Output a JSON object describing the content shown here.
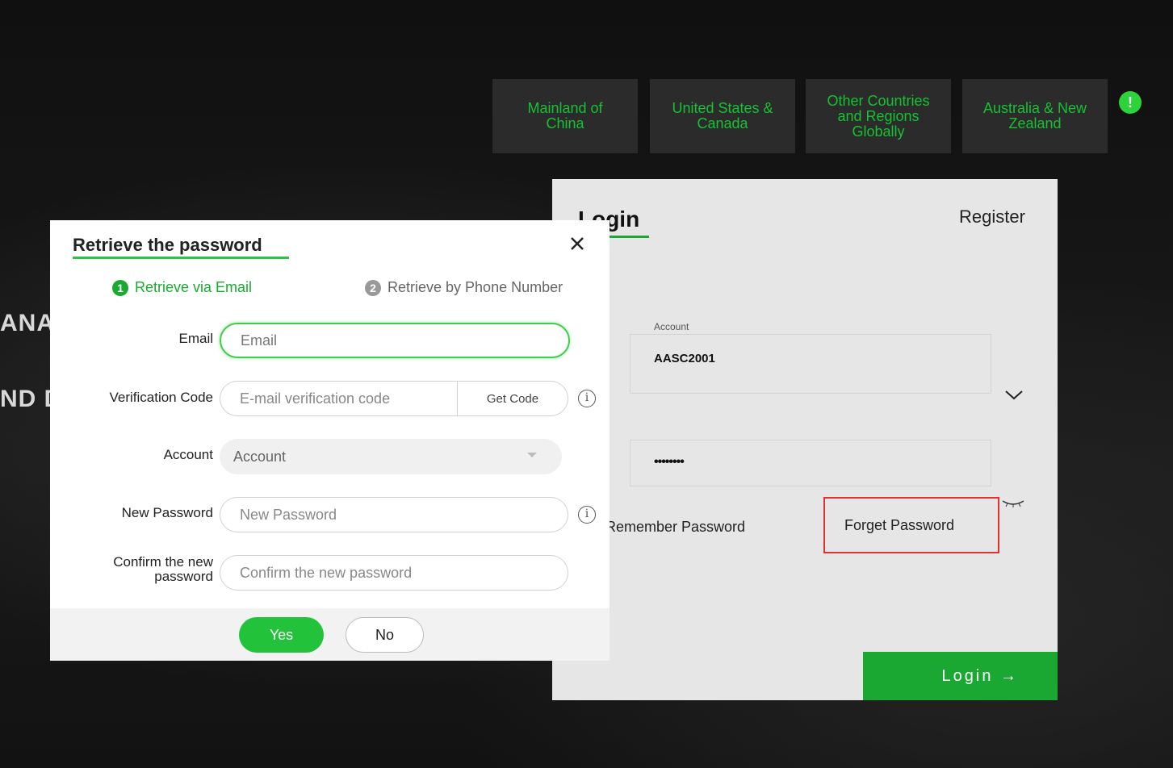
{
  "regions": [
    {
      "label": "Mainland of\nChina"
    },
    {
      "label": "United States &\nCanada"
    },
    {
      "label": "Other Countries\nand Regions\nGlobally"
    },
    {
      "label": "Australia & New\nZealand"
    }
  ],
  "alert_icon_glyph": "!",
  "hero": {
    "line1": "ANA",
    "line2": "ND D"
  },
  "login_panel": {
    "title": "Login",
    "register_label": "Register",
    "account_label": "Account",
    "account_value": "AASC2001",
    "password_value": "••••••••",
    "remember_label": "Remember Password",
    "forget_label": "Forget Password",
    "login_button": "Login →"
  },
  "modal": {
    "title": "Retrieve the password",
    "steps": [
      {
        "num": "1",
        "label": "Retrieve via Email"
      },
      {
        "num": "2",
        "label": "Retrieve by Phone Number"
      }
    ],
    "fields": {
      "email": {
        "label": "Email",
        "placeholder": "Email"
      },
      "verification": {
        "label": "Verification Code",
        "placeholder": "E-mail verification code",
        "button": "Get Code"
      },
      "account": {
        "label": "Account",
        "placeholder": "Account"
      },
      "new_password": {
        "label": "New Password",
        "placeholder": "New Password"
      },
      "confirm_password": {
        "label_line1": "Confirm the new",
        "label_line2": "password",
        "placeholder": "Confirm the new password"
      }
    },
    "yes_label": "Yes",
    "no_label": "No"
  },
  "colors": {
    "accent": "#1aa832",
    "highlight_box": "#e53030"
  }
}
